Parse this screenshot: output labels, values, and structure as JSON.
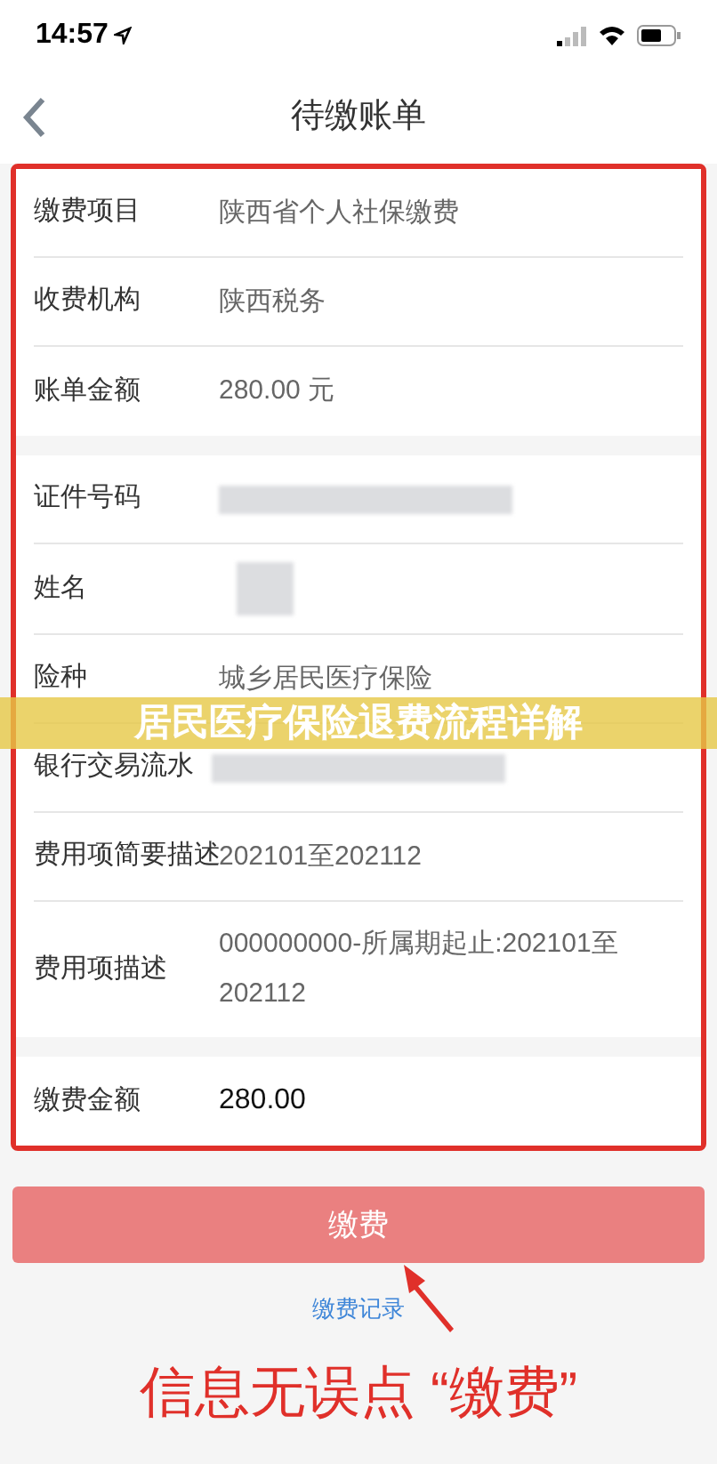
{
  "status_bar": {
    "time": "14:57"
  },
  "nav": {
    "title": "待缴账单"
  },
  "sections": [
    {
      "rows": [
        {
          "label": "缴费项目",
          "value": "陕西省个人社保缴费",
          "kind": "text"
        },
        {
          "label": "收费机构",
          "value": "陕西税务",
          "kind": "text"
        },
        {
          "label": "账单金额",
          "value": "280.00 元",
          "kind": "text"
        }
      ]
    },
    {
      "rows": [
        {
          "label": "证件号码",
          "kind": "masked_wide"
        },
        {
          "label": "姓名",
          "kind": "masked_small"
        },
        {
          "label": "险种",
          "value": "城乡居民医疗保险",
          "kind": "text"
        },
        {
          "label": "银行交易流水",
          "kind": "masked_wide"
        },
        {
          "label": "费用项简要描述",
          "value": "202101至202112",
          "kind": "text"
        },
        {
          "label": "费用项描述",
          "value": "000000000-所属期起止:202101至202112",
          "kind": "text"
        }
      ]
    },
    {
      "rows": [
        {
          "label": "缴费金额",
          "value": "280.00",
          "kind": "emphasis"
        }
      ]
    }
  ],
  "banner": {
    "text": "居民医疗保险退费流程详解"
  },
  "button": {
    "label": "缴费"
  },
  "link": "缴费记录",
  "annotation": {
    "text": "信息无误点 “缴费”"
  }
}
